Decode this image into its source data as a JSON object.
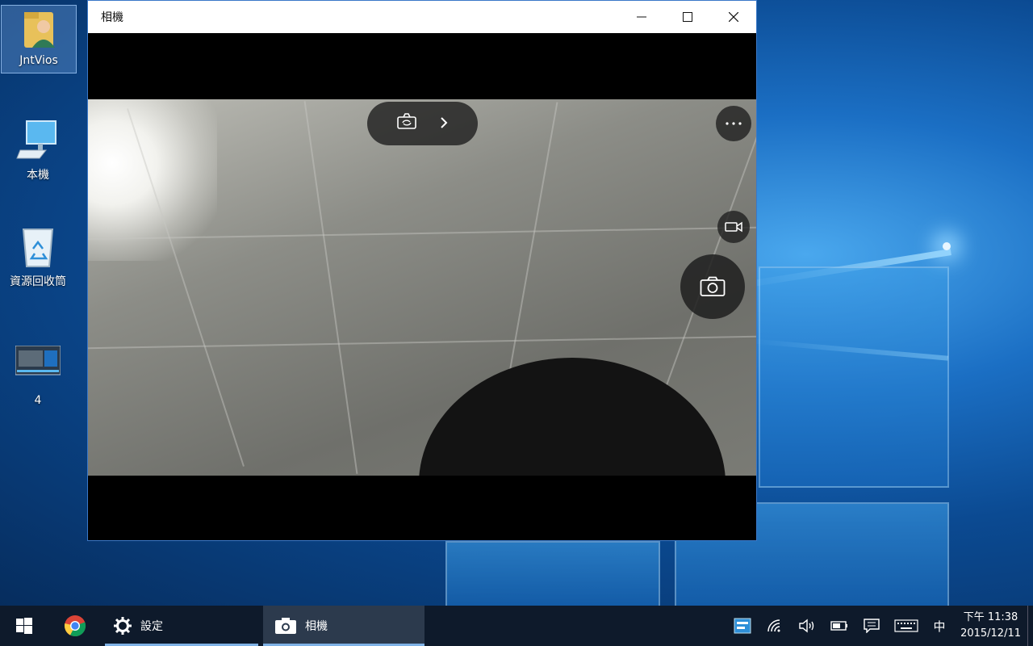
{
  "desktop": {
    "icons": [
      {
        "label": "JntVios",
        "icon": "user-folder-icon"
      },
      {
        "label": "本機",
        "icon": "computer-icon"
      },
      {
        "label": "資源回收筒",
        "icon": "recycle-bin-icon"
      },
      {
        "label": "4",
        "icon": "video-thumbnail-icon"
      }
    ]
  },
  "window": {
    "title": "相機",
    "controls": [
      "minimize",
      "maximize",
      "close"
    ]
  },
  "camera": {
    "switch_camera_icon": "camera-switch-icon",
    "expand_icon": "chevron-right-icon",
    "more_icon": "more-icon",
    "video_mode_icon": "video-camera-icon",
    "photo_icon": "camera-icon"
  },
  "taskbar": {
    "start_icon": "windows-start-icon",
    "apps": [
      {
        "label": "",
        "icon": "chrome-icon"
      },
      {
        "label": "設定",
        "icon": "gear-icon"
      },
      {
        "label": "相機",
        "icon": "camera-icon"
      }
    ],
    "tray": {
      "ime_label": "中",
      "time": "下午 11:38",
      "date": "2015/12/11"
    }
  },
  "colors": {
    "accent": "#0078d7",
    "taskbar": "#0e1a2b",
    "window_border": "#3a78c8"
  }
}
